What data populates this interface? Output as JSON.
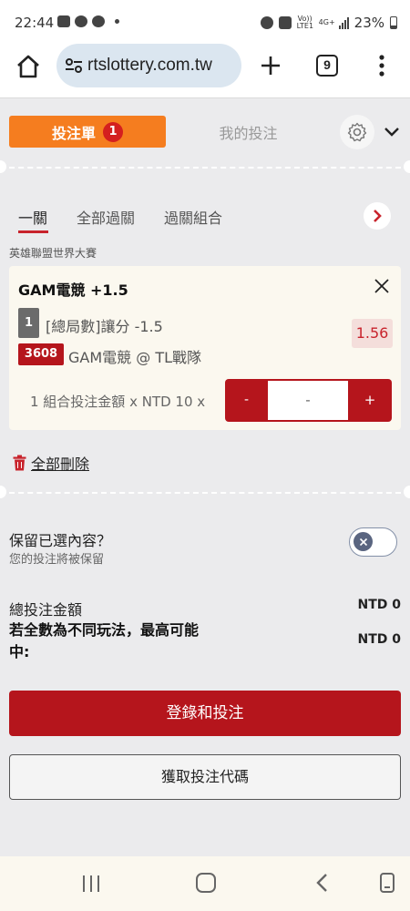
{
  "status_bar": {
    "time": "22:44",
    "volte": "Vo)) LTE1",
    "net": "4G+",
    "battery": "23%"
  },
  "browser": {
    "url": "rtslottery.com.tw",
    "tab_count": "9"
  },
  "betslip": {
    "tab_active_label": "投注單",
    "tab_active_badge": "1",
    "tab_inactive_label": "我的投注"
  },
  "bet_types": {
    "tabs": [
      "一關",
      "全部過關",
      "過關組合"
    ],
    "selected": "一關"
  },
  "league": "英雄聯盟世界大賽",
  "bet": {
    "title": "GAM電競 +1.5",
    "period": "1",
    "market": "[總局數]讓分 -1.5",
    "odds": "1.56",
    "match_id": "3608",
    "match_name": "GAM電競 @ TL戰隊",
    "stake_label": "1 組合投注金額 x NTD 10 x",
    "stepper_minus": "-",
    "stepper_value": "-",
    "stepper_plus": "+"
  },
  "delete_all": "全部刪除",
  "keep": {
    "title": "保留已選內容？",
    "subtitle": "您的投注將被保留"
  },
  "summary": {
    "total_label": "總投注金額",
    "total_value": "NTD 0",
    "max_label": "若全數為不同玩法，最高可能中:",
    "max_value": "NTD 0"
  },
  "buttons": {
    "login_bet": "登錄和投注",
    "get_code": "獲取投注代碼"
  },
  "colors": {
    "accent_orange": "#f57d1f",
    "brand_red": "#b5151c",
    "odds_bg": "#f4dedb"
  }
}
